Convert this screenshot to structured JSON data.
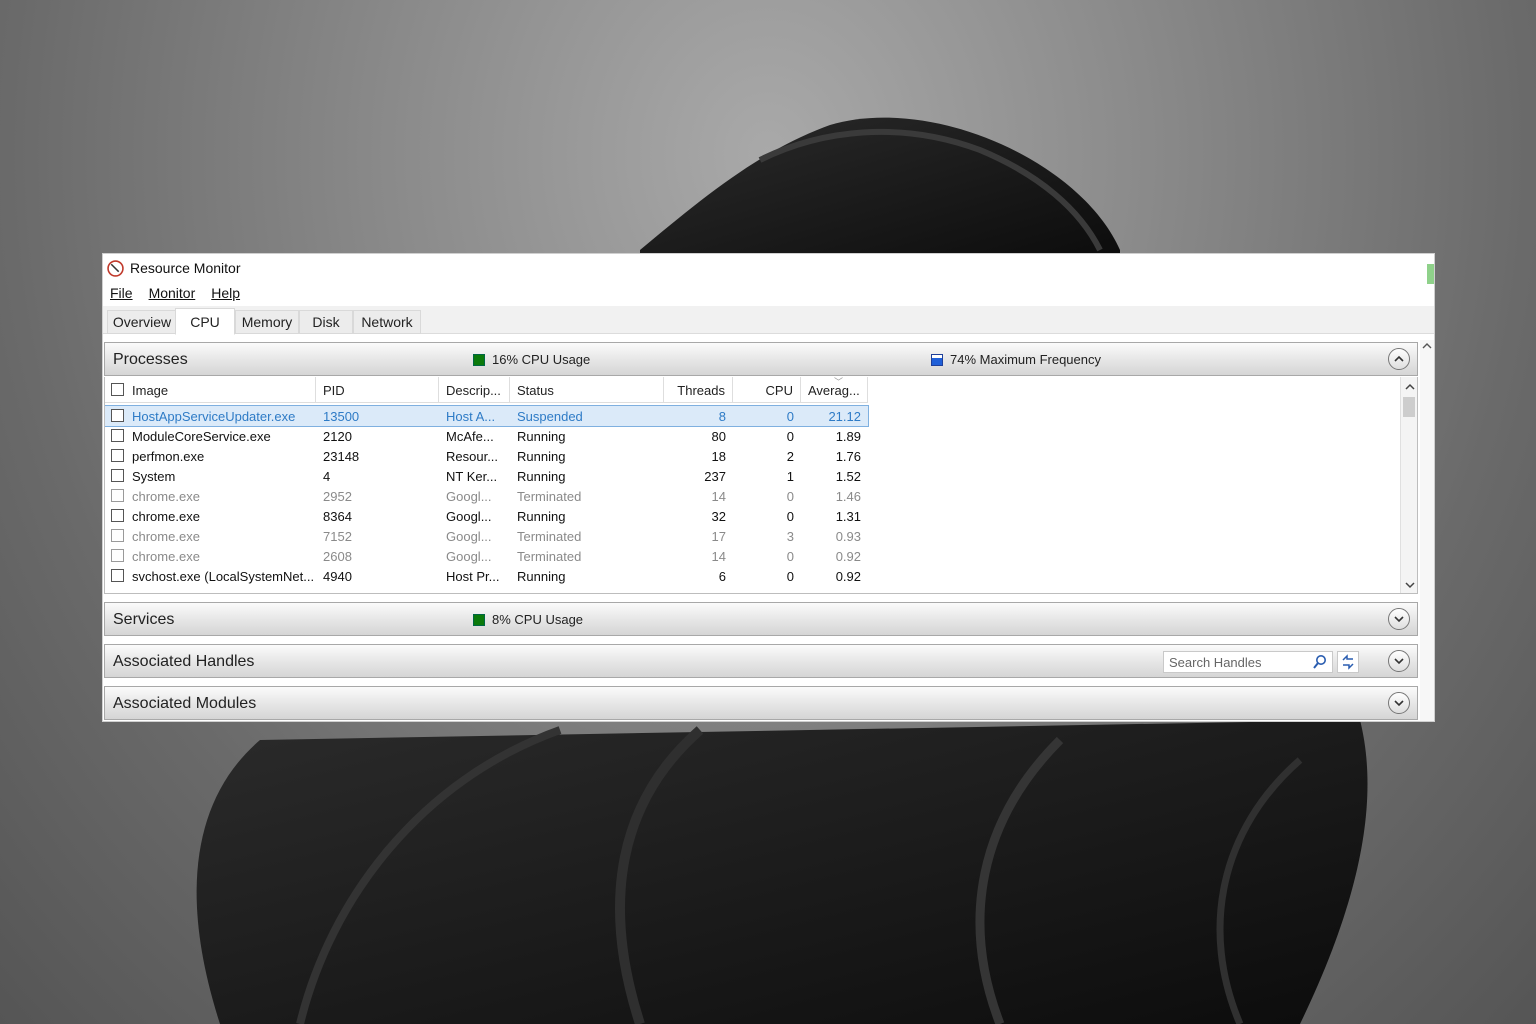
{
  "window": {
    "title": "Resource Monitor"
  },
  "menu": [
    "File",
    "Monitor",
    "Help"
  ],
  "tabs": [
    "Overview",
    "CPU",
    "Memory",
    "Disk",
    "Network"
  ],
  "active_tab": "CPU",
  "processes": {
    "title": "Processes",
    "cpu_usage": "16% CPU Usage",
    "max_frequency": "74% Maximum Frequency",
    "columns": [
      "Image",
      "PID",
      "Descrip...",
      "Status",
      "Threads",
      "CPU",
      "Averag..."
    ],
    "rows": [
      [
        "HostAppServiceUpdater.exe",
        "13500",
        "Host A...",
        "Suspended",
        "8",
        "0",
        "21.12"
      ],
      [
        "ModuleCoreService.exe",
        "2120",
        "McAfe...",
        "Running",
        "80",
        "0",
        "1.89"
      ],
      [
        "perfmon.exe",
        "23148",
        "Resour...",
        "Running",
        "18",
        "2",
        "1.76"
      ],
      [
        "System",
        "4",
        "NT Ker...",
        "Running",
        "237",
        "1",
        "1.52"
      ],
      [
        "chrome.exe",
        "2952",
        "Googl...",
        "Terminated",
        "14",
        "0",
        "1.46"
      ],
      [
        "chrome.exe",
        "8364",
        "Googl...",
        "Running",
        "32",
        "0",
        "1.31"
      ],
      [
        "chrome.exe",
        "7152",
        "Googl...",
        "Terminated",
        "17",
        "3",
        "0.93"
      ],
      [
        "chrome.exe",
        "2608",
        "Googl...",
        "Terminated",
        "14",
        "0",
        "0.92"
      ],
      [
        "svchost.exe (LocalSystemNet...",
        "4940",
        "Host Pr...",
        "Running",
        "6",
        "0",
        "0.92"
      ]
    ]
  },
  "services": {
    "title": "Services",
    "cpu_usage": "8% CPU Usage"
  },
  "handles": {
    "title": "Associated Handles",
    "search_placeholder": "Search Handles"
  },
  "modules": {
    "title": "Associated Modules"
  },
  "colors": {
    "cpu_usage_swatch": "#0b7a0b",
    "frequency_swatch": "#1f5fd8",
    "selected_row_text": "#2e7bc6"
  }
}
